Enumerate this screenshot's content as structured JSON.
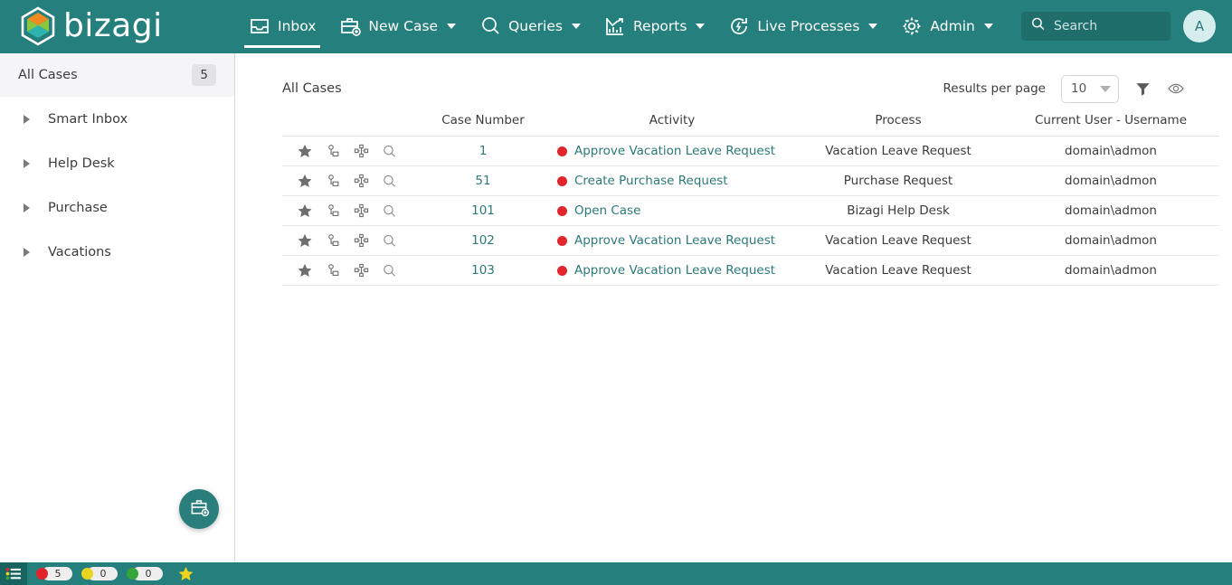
{
  "brand": {
    "name": "bizagi",
    "logo_icon": "bizagi-hexagon-logo",
    "primary_color": "#25807d",
    "accent_color": "#2a7a78",
    "status_red": "#e1252b",
    "status_yellow": "#e8d421",
    "status_green": "#35a63a"
  },
  "header": {
    "nav": [
      {
        "label": "Inbox",
        "icon": "inbox-tray-icon",
        "active": true,
        "has_caret": false
      },
      {
        "label": "New Case",
        "icon": "briefcase-plus-icon",
        "active": false,
        "has_caret": true
      },
      {
        "label": "Queries",
        "icon": "magnifier-icon",
        "active": false,
        "has_caret": true
      },
      {
        "label": "Reports",
        "icon": "chart-trend-icon",
        "active": false,
        "has_caret": true
      },
      {
        "label": "Live Processes",
        "icon": "refresh-bolt-icon",
        "active": false,
        "has_caret": true
      },
      {
        "label": "Admin",
        "icon": "gear-icon",
        "active": false,
        "has_caret": true
      }
    ],
    "search": {
      "placeholder": "Search",
      "value": "",
      "icon": "search-icon"
    },
    "avatar": {
      "initial": "A"
    }
  },
  "sidebar": {
    "header": {
      "label": "All Cases",
      "count": "5"
    },
    "items": [
      {
        "label": "Smart Inbox"
      },
      {
        "label": "Help Desk"
      },
      {
        "label": "Purchase"
      },
      {
        "label": "Vacations"
      }
    ],
    "fab": {
      "icon": "briefcase-plus-icon",
      "tooltip": "New Case"
    }
  },
  "main": {
    "title": "All Cases",
    "results_per_page": {
      "label": "Results per page",
      "value": "10"
    },
    "filter_icon": "funnel-filter-icon",
    "visibility_icon": "eye-icon",
    "table": {
      "columns": [
        "",
        "Case Number",
        "Activity",
        "Process",
        "Current User - Username"
      ],
      "row_icons": [
        "star-icon",
        "case-link-icon",
        "process-flow-icon",
        "magnifier-icon"
      ],
      "rows": [
        {
          "case_number": "1",
          "activity": "Approve Vacation Leave Request",
          "process": "Vacation Leave Request",
          "user": "domain\\admon",
          "status": "red"
        },
        {
          "case_number": "51",
          "activity": "Create Purchase Request",
          "process": "Purchase Request",
          "user": "domain\\admon",
          "status": "red"
        },
        {
          "case_number": "101",
          "activity": "Open Case",
          "process": "Bizagi Help Desk",
          "user": "domain\\admon",
          "status": "red"
        },
        {
          "case_number": "102",
          "activity": "Approve Vacation Leave Request",
          "process": "Vacation Leave Request",
          "user": "domain\\admon",
          "status": "red"
        },
        {
          "case_number": "103",
          "activity": "Approve Vacation Leave Request",
          "process": "Vacation Leave Request",
          "user": "domain\\admon",
          "status": "red"
        }
      ]
    }
  },
  "statusbar": {
    "list_icon": "status-list-icon",
    "counters": [
      {
        "color": "red",
        "value": "5"
      },
      {
        "color": "yellow",
        "value": "0"
      },
      {
        "color": "green",
        "value": "0"
      }
    ],
    "star_icon": "star-favorite-icon"
  }
}
